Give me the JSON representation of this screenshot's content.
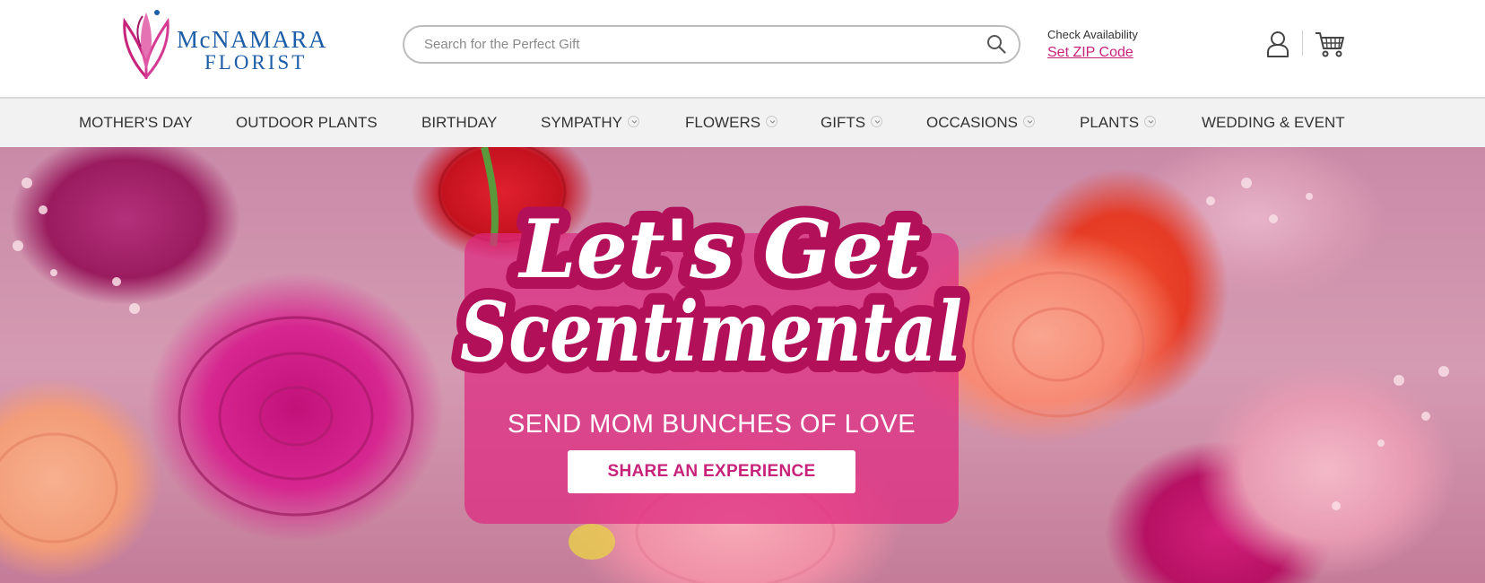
{
  "brand": {
    "name_line1_mc": "Mc",
    "name_line1_rest": "NAMARA",
    "name_line2": "FLORIST"
  },
  "search": {
    "placeholder": "Search for the Perfect Gift",
    "icon": "search-icon"
  },
  "availability": {
    "label": "Check Availability",
    "link": "Set ZIP Code"
  },
  "header_icons": {
    "account": "user-icon",
    "cart": "cart-icon"
  },
  "nav": {
    "items": [
      {
        "label": "MOTHER'S DAY",
        "has_dropdown": false
      },
      {
        "label": "OUTDOOR PLANTS",
        "has_dropdown": false
      },
      {
        "label": "BIRTHDAY",
        "has_dropdown": false
      },
      {
        "label": "SYMPATHY",
        "has_dropdown": true
      },
      {
        "label": "FLOWERS",
        "has_dropdown": true
      },
      {
        "label": "GIFTS",
        "has_dropdown": true
      },
      {
        "label": "OCCASIONS",
        "has_dropdown": true
      },
      {
        "label": "PLANTS",
        "has_dropdown": true
      },
      {
        "label": "WEDDING & EVENT",
        "has_dropdown": false
      }
    ]
  },
  "hero": {
    "headline_line1": "Let's Get",
    "headline_line2": "Scentimental",
    "subheadline": "SEND MOM BUNCHES OF LOVE",
    "cta": "SHARE AN EXPERIENCE"
  },
  "colors": {
    "brand_blue": "#1d5ea8",
    "brand_magenta": "#c8237b",
    "headline_outline": "#b3105a",
    "nav_background": "#f2f2f2"
  }
}
